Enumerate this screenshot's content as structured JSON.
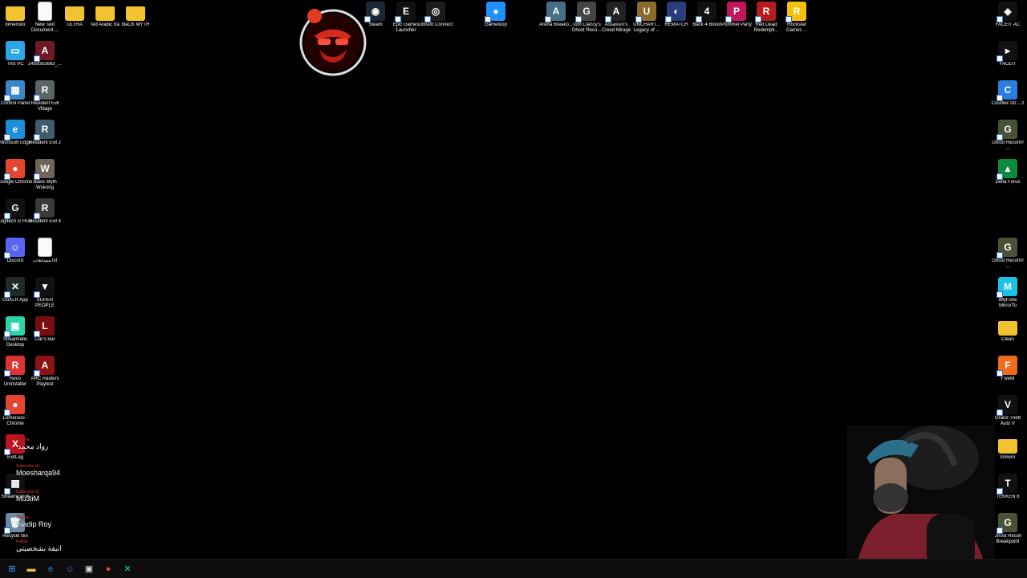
{
  "desktop": {
    "icons": [
      {
        "label": "lomerooo",
        "kind": "folder",
        "color": "#f2c230",
        "glyph": ""
      },
      {
        "label": "New Text Document....",
        "kind": "doc",
        "color": "#fafafa",
        "glyph": ""
      },
      {
        "label": "ULTRA",
        "kind": "folder",
        "color": "#f2c230",
        "glyph": ""
      },
      {
        "label": "red Arabic tra",
        "kind": "folder",
        "color": "#f2c230",
        "glyph": ""
      },
      {
        "label": "blaCK MYTH",
        "kind": "folder",
        "color": "#f2c230",
        "glyph": ""
      },
      {
        "label": "This PC",
        "kind": "app",
        "color": "#2aa7e6",
        "glyph": "▭"
      },
      {
        "label": "2459353663_...",
        "kind": "app",
        "color": "#6d1a24",
        "glyph": "A"
      },
      {
        "label": "Control Panel",
        "kind": "app",
        "color": "#3b88c9",
        "glyph": "▦"
      },
      {
        "label": "Resident Evil Village",
        "kind": "app",
        "color": "#5b6566",
        "glyph": "R"
      },
      {
        "label": "Microsoft Edge",
        "kind": "app",
        "color": "#1b8fd8",
        "glyph": "e"
      },
      {
        "label": "Resident Evil 2",
        "kind": "app",
        "color": "#3f5c6a",
        "glyph": "R"
      },
      {
        "label": "Google Chrome",
        "kind": "app",
        "color": "#e6452f",
        "glyph": "●"
      },
      {
        "label": "Black Myth Wukong",
        "kind": "app",
        "color": "#6f6457",
        "glyph": "W"
      },
      {
        "label": "Logitech G HUB",
        "kind": "app",
        "color": "#111",
        "glyph": "G"
      },
      {
        "label": "Resident Evil 4",
        "kind": "app",
        "color": "#3a3a3a",
        "glyph": "R"
      },
      {
        "label": "Discord",
        "kind": "app",
        "color": "#5865f2",
        "glyph": "☺"
      },
      {
        "label": "مسابقات.txt",
        "kind": "doc",
        "color": "#fafafa",
        "glyph": ""
      },
      {
        "label": "GoXLR App",
        "kind": "app",
        "color": "#1e2a2a",
        "glyph": "✕"
      },
      {
        "label": "SUPER PEOPLE",
        "kind": "app",
        "color": "#111",
        "glyph": "▼"
      },
      {
        "label": "Streamlabs Desktop",
        "kind": "app",
        "color": "#29d6a6",
        "glyph": "▣"
      },
      {
        "label": "Liar's Bar",
        "kind": "app",
        "color": "#7a0e0e",
        "glyph": "L"
      },
      {
        "label": "Revo Uninstaller",
        "kind": "app",
        "color": "#d33",
        "glyph": "R"
      },
      {
        "label": "ARC Raiders Playtest",
        "kind": "app",
        "color": "#8a1313",
        "glyph": "A"
      },
      {
        "label": "Lomerooo - Chrome",
        "kind": "app",
        "color": "#e6452f",
        "glyph": "●"
      },
      {
        "label": "ExitLag",
        "kind": "app",
        "color": "#c1121f",
        "glyph": "X"
      },
      {
        "label": "Stream Deck",
        "kind": "app",
        "color": "#111",
        "glyph": "▦"
      },
      {
        "label": "Recycle Bin",
        "kind": "app",
        "color": "#6b8aa5",
        "glyph": "🗑"
      },
      {
        "label": "Steam",
        "kind": "app",
        "color": "#1b2838",
        "glyph": "◉"
      },
      {
        "label": "Epic Games Launcher",
        "kind": "app",
        "color": "#111",
        "glyph": "E"
      },
      {
        "label": "Ubisoft Connect",
        "kind": "app",
        "color": "#1c1c1c",
        "glyph": "◎"
      },
      {
        "label": "Gameloop",
        "kind": "app",
        "color": "#1e90ff",
        "glyph": "●"
      },
      {
        "label": "Arena Breako...",
        "kind": "app",
        "color": "#466e85",
        "glyph": "A"
      },
      {
        "label": "Tom Clancy's Ghost Reco...",
        "kind": "app",
        "color": "#444",
        "glyph": "G"
      },
      {
        "label": "Assassin's Creed Mirage",
        "kind": "app",
        "color": "#222",
        "glyph": "A"
      },
      {
        "label": "UNCHART... Legacy of ...",
        "kind": "app",
        "color": "#8a6b2b",
        "glyph": "U"
      },
      {
        "label": "REMATCH",
        "kind": "app",
        "color": "#2a3d7a",
        "glyph": "◐"
      },
      {
        "label": "Back 4 Blood",
        "kind": "app",
        "color": "#111",
        "glyph": "4"
      },
      {
        "label": "Pummel Party",
        "kind": "app",
        "color": "#c2185b",
        "glyph": "P"
      },
      {
        "label": "Red Dead Redempti...",
        "kind": "app",
        "color": "#b71c1c",
        "glyph": "R"
      },
      {
        "label": "Rockstar Games ...",
        "kind": "app",
        "color": "#f4c20d",
        "glyph": "R"
      },
      {
        "label": "FACEIT AC",
        "kind": "app",
        "color": "#111",
        "glyph": "◈"
      },
      {
        "label": "FACEIT",
        "kind": "app",
        "color": "#111",
        "glyph": "▸"
      },
      {
        "label": "Counter-Str... 2",
        "kind": "app",
        "color": "#2b7de0",
        "glyph": "C"
      },
      {
        "label": "Ghost Recon® ...",
        "kind": "app",
        "color": "#4a5236",
        "glyph": "G"
      },
      {
        "label": "Delta Force",
        "kind": "app",
        "color": "#0c8a3e",
        "glyph": "▲"
      },
      {
        "label": "Ghost Recon® ...",
        "kind": "app",
        "color": "#4a5236",
        "glyph": "G"
      },
      {
        "label": "iMyFone MirrorTo",
        "kind": "app",
        "color": "#19c2e6",
        "glyph": "M"
      },
      {
        "label": "Clean",
        "kind": "folder",
        "color": "#f2c230",
        "glyph": ""
      },
      {
        "label": "FiveM",
        "kind": "app",
        "color": "#f26a1b",
        "glyph": "F"
      },
      {
        "label": "Grand Theft Auto V",
        "kind": "app",
        "color": "#111",
        "glyph": "V"
      },
      {
        "label": "lomero",
        "kind": "folder",
        "color": "#f2c230",
        "glyph": ""
      },
      {
        "label": "TEKKEN 8",
        "kind": "app",
        "color": "#111",
        "glyph": "T"
      },
      {
        "label": "Ghost Recon Breakpoint",
        "kind": "app",
        "color": "#4a5236",
        "glyph": "G"
      }
    ]
  },
  "chat": [
    {
      "badge": "Follow",
      "name": "رواد محمد"
    },
    {
      "badge": "Subscribe x5",
      "name": "Moesharqa94"
    },
    {
      "badge": "Subscribe x5",
      "name": "Mu3liM"
    },
    {
      "badge": "Follow",
      "name": "Nadip Roy"
    },
    {
      "badge": "Follow",
      "name": "انيقة بشخصيتي"
    }
  ],
  "taskbar": {
    "items": [
      {
        "name": "start-button",
        "glyph": "⊞",
        "color": "#3aa0ff"
      },
      {
        "name": "file-explorer-button",
        "glyph": "▬",
        "color": "#f2c230"
      },
      {
        "name": "edge-button",
        "glyph": "e",
        "color": "#1b8fd8"
      },
      {
        "name": "discord-button",
        "glyph": "☺",
        "color": "#5865f2"
      },
      {
        "name": "store-button",
        "glyph": "▣",
        "color": "#ddd"
      },
      {
        "name": "chrome-button",
        "glyph": "●",
        "color": "#e6452f"
      },
      {
        "name": "goxlr-button",
        "glyph": "✕",
        "color": "#29d6a6"
      }
    ]
  }
}
